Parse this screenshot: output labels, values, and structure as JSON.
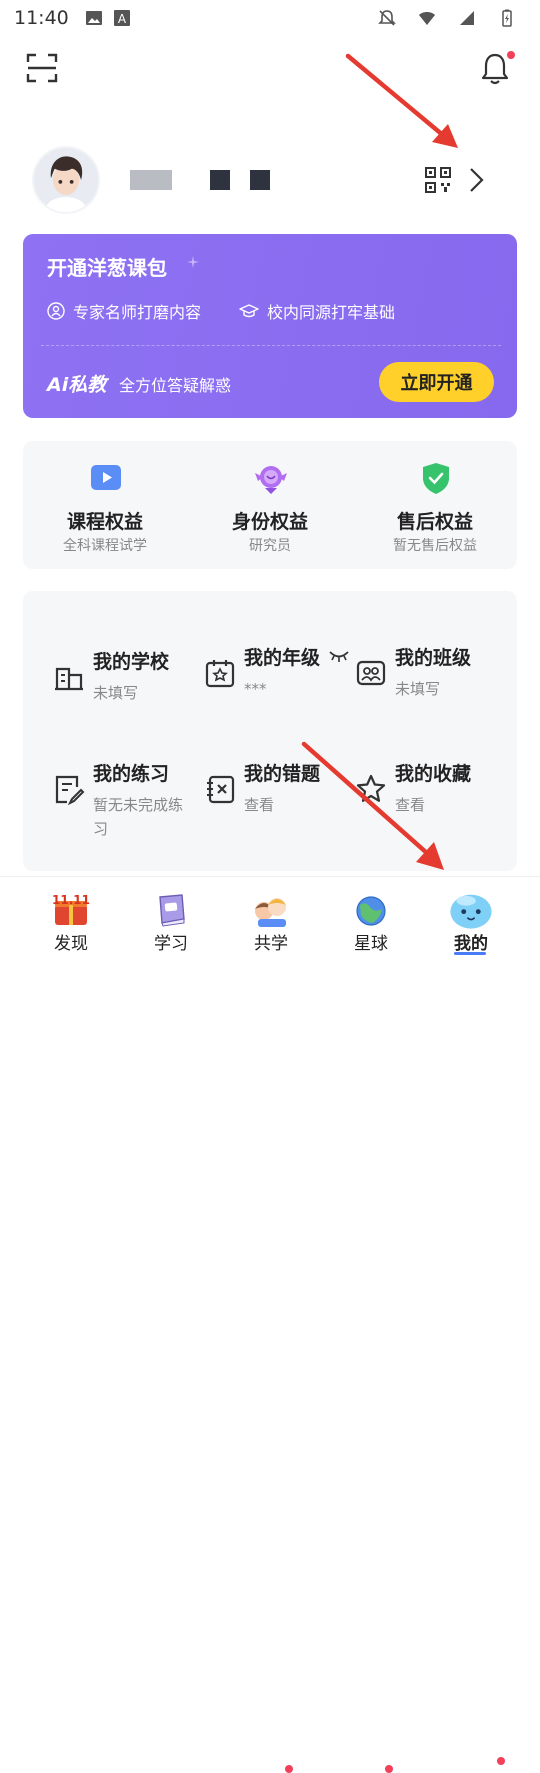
{
  "status_bar": {
    "time": "11:40"
  },
  "header": {
    "notification_dot_color": "#f2405a"
  },
  "profile": {
    "name_masked": true
  },
  "promo": {
    "title": "开通洋葱课包",
    "feature_1": "专家名师打磨内容",
    "feature_2": "校内同源打牢基础",
    "ai_logo": "Ai私教",
    "ai_desc": "全方位答疑解惑",
    "button_label": "立即开通",
    "accent_color": "#8a6cf0",
    "button_color": "#ffd02a"
  },
  "benefits": [
    {
      "title": "课程权益",
      "sub": "全科课程试学",
      "icon": "play-icon"
    },
    {
      "title": "身份权益",
      "sub": "研究员",
      "icon": "badge-icon"
    },
    {
      "title": "售后权益",
      "sub": "暂无售后权益",
      "icon": "shield-check-icon"
    }
  ],
  "grid": [
    {
      "title": "我的学校",
      "sub": "未填写",
      "icon": "school-icon"
    },
    {
      "title": "我的年级",
      "sub": "***",
      "icon": "grade-icon"
    },
    {
      "title": "我的班级",
      "sub": "未填写",
      "icon": "class-icon"
    },
    {
      "title": "我的练习",
      "sub": "暂无未完成练习",
      "icon": "practice-icon"
    },
    {
      "title": "我的错题",
      "sub": "查看",
      "icon": "mistakes-icon"
    },
    {
      "title": "我的收藏",
      "sub": "查看",
      "icon": "star-icon"
    }
  ],
  "tabs": [
    {
      "label": "发现",
      "active": false
    },
    {
      "label": "学习",
      "active": false
    },
    {
      "label": "共学",
      "active": false
    },
    {
      "label": "星球",
      "active": false
    },
    {
      "label": "我的",
      "active": true
    }
  ]
}
